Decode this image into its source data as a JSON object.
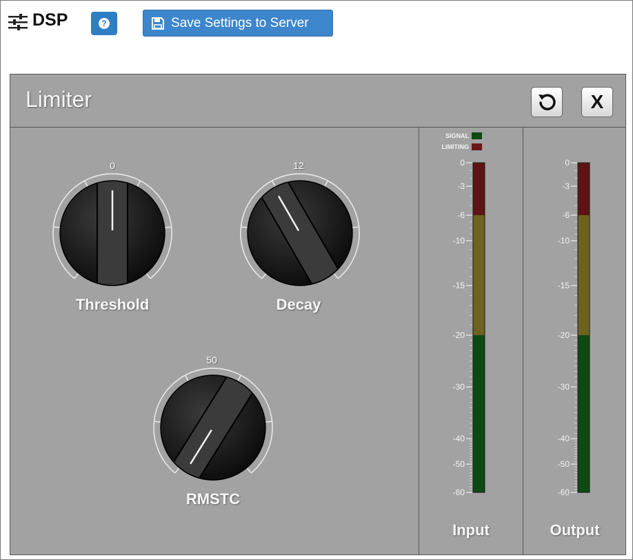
{
  "toolbar": {
    "title": "DSP",
    "help_label": "?",
    "save_label": "Save Settings to Server"
  },
  "panel": {
    "title": "Limiter",
    "close_label": "X"
  },
  "knobs": {
    "threshold": {
      "label": "Threshold",
      "value": "0"
    },
    "decay": {
      "label": "Decay",
      "value": "12"
    },
    "rmstc": {
      "label": "RMSTC",
      "value": "50"
    }
  },
  "meters": {
    "input": {
      "caption": "Input"
    },
    "output": {
      "caption": "Output"
    },
    "legend": {
      "signal": "SIGNAL",
      "limiting": "LIMITING"
    },
    "scale": [
      "0",
      "-3",
      "-6",
      "-10",
      "-15",
      "-20",
      "-30",
      "-40",
      "-50",
      "-60"
    ]
  },
  "colors": {
    "accent": "#3d86cc",
    "panel_bg": "#a2a2a2",
    "meter_red": "#5e1414",
    "meter_yellow": "#6e621f",
    "meter_green": "#0d4a12",
    "signal_led": "#0d4a12",
    "limiting_led": "#6b1616"
  }
}
